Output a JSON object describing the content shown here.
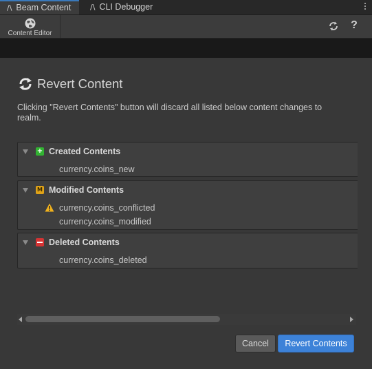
{
  "tabs": [
    {
      "label": "Beam Content",
      "glyph": "/\\",
      "active": true
    },
    {
      "label": "CLI Debugger",
      "glyph": "/\\",
      "active": false
    }
  ],
  "toolbar": {
    "content_editor_label": "Content Editor",
    "refresh_icon": "refresh-icon",
    "help_icon": "?"
  },
  "revert": {
    "title": "Revert Content",
    "description": "Clicking \"Revert Contents\" button will discard all listed below content changes to realm."
  },
  "groups": {
    "created": {
      "title": "Created Contents",
      "items": [
        "currency.coins_new"
      ]
    },
    "modified": {
      "title": "Modified Contents",
      "items": [
        "currency.coins_conflicted",
        "currency.coins_modified"
      ]
    },
    "deleted": {
      "title": "Deleted Contents",
      "items": [
        "currency.coins_deleted"
      ]
    }
  },
  "badges": {
    "created": "+",
    "modified": "M"
  },
  "buttons": {
    "cancel": "Cancel",
    "revert": "Revert Contents"
  },
  "colors": {
    "accent": "#3d82d8",
    "created": "#32b332",
    "modified": "#e0a318",
    "deleted": "#d53434",
    "warning": "#f0b21d"
  }
}
